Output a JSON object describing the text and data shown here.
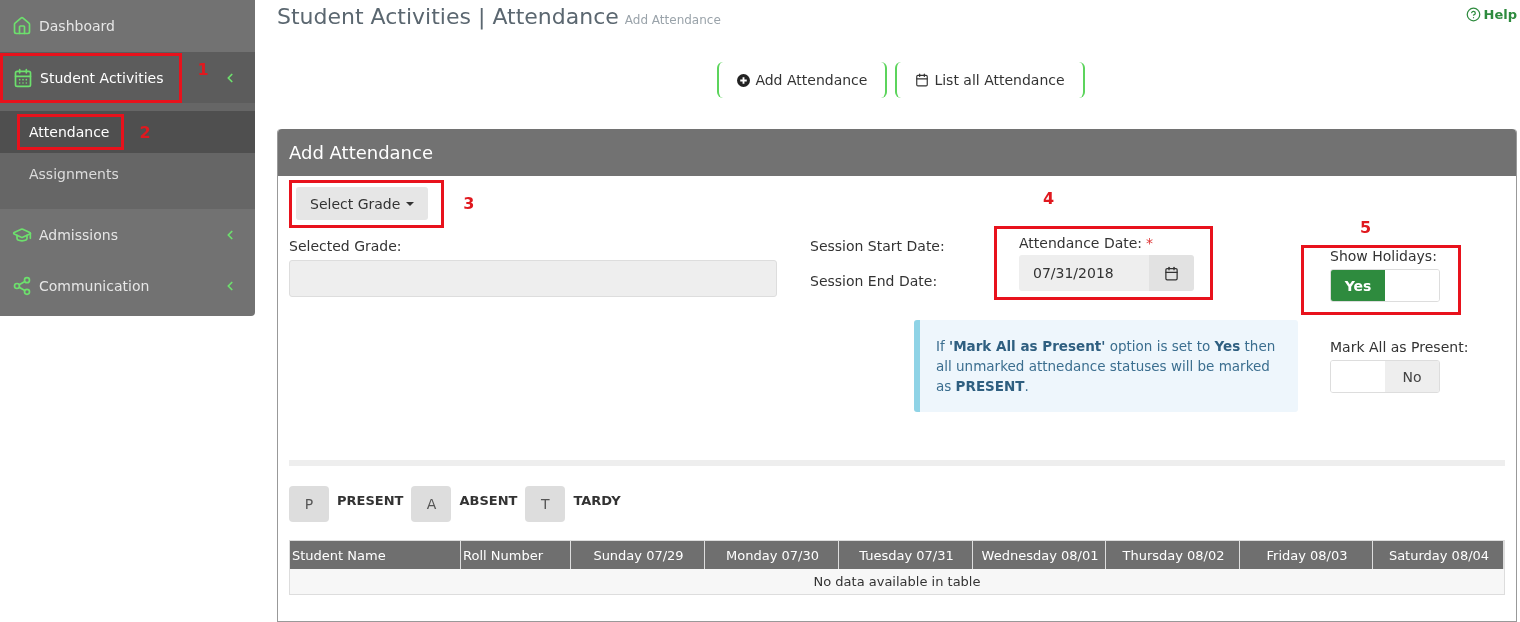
{
  "sidebar": {
    "items": [
      {
        "label": "Dashboard",
        "selected": false
      },
      {
        "label": "Student Activities",
        "selected": true,
        "callout": "1",
        "children": [
          {
            "label": "Attendance",
            "selected": true,
            "callout": "2"
          },
          {
            "label": "Assignments",
            "selected": false
          }
        ]
      },
      {
        "label": "Admissions",
        "selected": false
      },
      {
        "label": "Communication",
        "selected": false
      }
    ]
  },
  "header": {
    "title": "Student Activities",
    "separator": "|",
    "section": "Attendance",
    "subtitle": "Add Attendance",
    "help": "Help"
  },
  "actions": [
    {
      "label": "Add Attendance"
    },
    {
      "label": "List all Attendance"
    }
  ],
  "panel": {
    "title": "Add Attendance",
    "grade_button": {
      "label": "Select Grade",
      "callout": "3"
    },
    "selected_grade": {
      "label": "Selected Grade:"
    },
    "session": {
      "start_label": "Session Start Date:",
      "end_label": "Session End Date:"
    },
    "attendance_date": {
      "label": "Attendance Date:",
      "required_mark": "*",
      "value": "07/31/2018",
      "callout": "4"
    },
    "toggles": [
      {
        "label": "Show Holidays:",
        "on": true,
        "text": "Yes",
        "callout": "5"
      },
      {
        "label": "Mark All as Present:",
        "on": false,
        "text": "No"
      }
    ],
    "info": "If  **'Mark All as Present'** option is set to **Yes** then all unmarked attnedance statuses will be marked as **PRESENT**.",
    "legend": [
      {
        "key": "P",
        "label": "PRESENT"
      },
      {
        "key": "A",
        "label": "ABSENT"
      },
      {
        "key": "T",
        "label": "TARDY"
      }
    ],
    "table": {
      "columns": [
        "Student Name",
        "Roll Number",
        "Sunday 07/29",
        "Monday 07/30",
        "Tuesday 07/31",
        "Wednesday 08/01",
        "Thursday 08/02",
        "Friday 08/03",
        "Saturday 08/04"
      ],
      "empty_message": "No data available in table"
    }
  }
}
